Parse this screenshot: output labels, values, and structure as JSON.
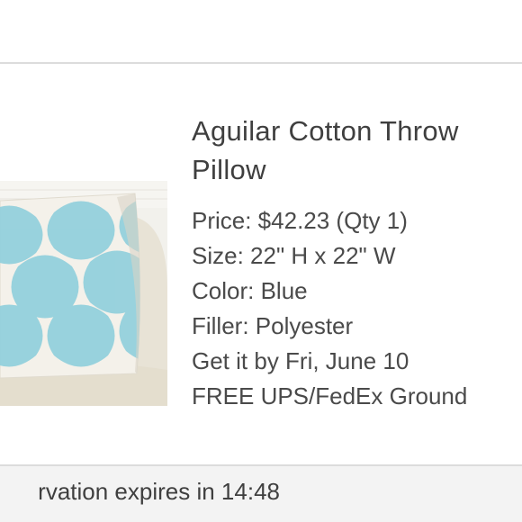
{
  "product": {
    "title": "Aguilar Cotton Throw Pillow",
    "image_alt": "Aguilar Cotton Throw Pillow",
    "pattern_color": "#8fcfdc",
    "pillow_color": "#f4f1ea",
    "details": [
      "Price: $42.23 (Qty 1)",
      "Size: 22\" H x 22\" W",
      "Color: Blue",
      "Filler: Polyester",
      "Get it by Fri, June 10",
      "FREE UPS/FedEx Ground"
    ]
  },
  "reservation": {
    "text": "rvation expires in 14:48"
  }
}
